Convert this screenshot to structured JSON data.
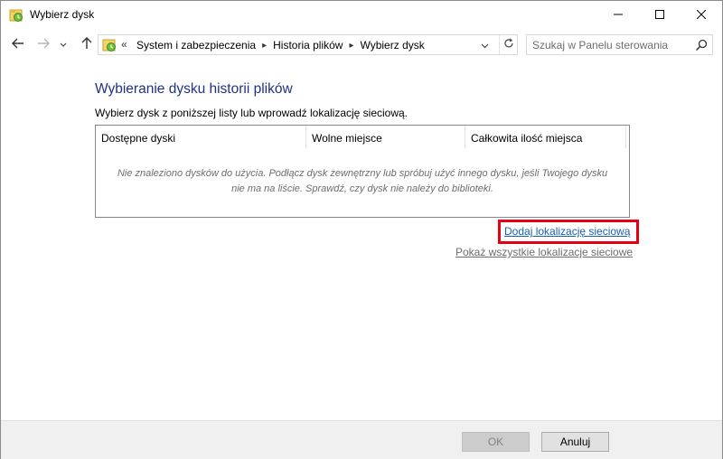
{
  "window": {
    "title": "Wybierz dysk",
    "app_icon": "file-history-icon"
  },
  "controls": {
    "minimize": "minimize-icon",
    "maximize": "maximize-icon",
    "close": "close-icon"
  },
  "nav": {
    "back": "arrow-left-icon",
    "forward": "arrow-right-icon",
    "recent": "chevron-down-icon",
    "up": "arrow-up-icon"
  },
  "address": {
    "overflow": "«",
    "crumbs": [
      "System i zabezpieczenia",
      "Historia plików",
      "Wybierz dysk"
    ]
  },
  "search": {
    "placeholder": "Szukaj w Panelu sterowania"
  },
  "main": {
    "heading": "Wybieranie dysku historii plików",
    "subtext": "Wybierz dysk z poniższej listy lub wprowadź lokalizację sieciową.",
    "columns": [
      "Dostępne dyski",
      "Wolne miejsce",
      "Całkowita ilość miejsca"
    ],
    "empty_message_line1": "Nie znaleziono dysków do użycia. Podłącz dysk zewnętrzny lub spróbuj użyć innego dysku, jeśli Twojego dysku",
    "empty_message_line2": "nie ma na liście. Sprawdź, czy dysk nie należy do biblioteki.",
    "add_network_link": "Dodaj lokalizację sieciową",
    "show_network_link": "Pokaż wszystkie lokalizacje sieciowe",
    "highlight_color": "#e60012"
  },
  "footer": {
    "ok_label": "OK",
    "cancel_label": "Anuluj"
  }
}
